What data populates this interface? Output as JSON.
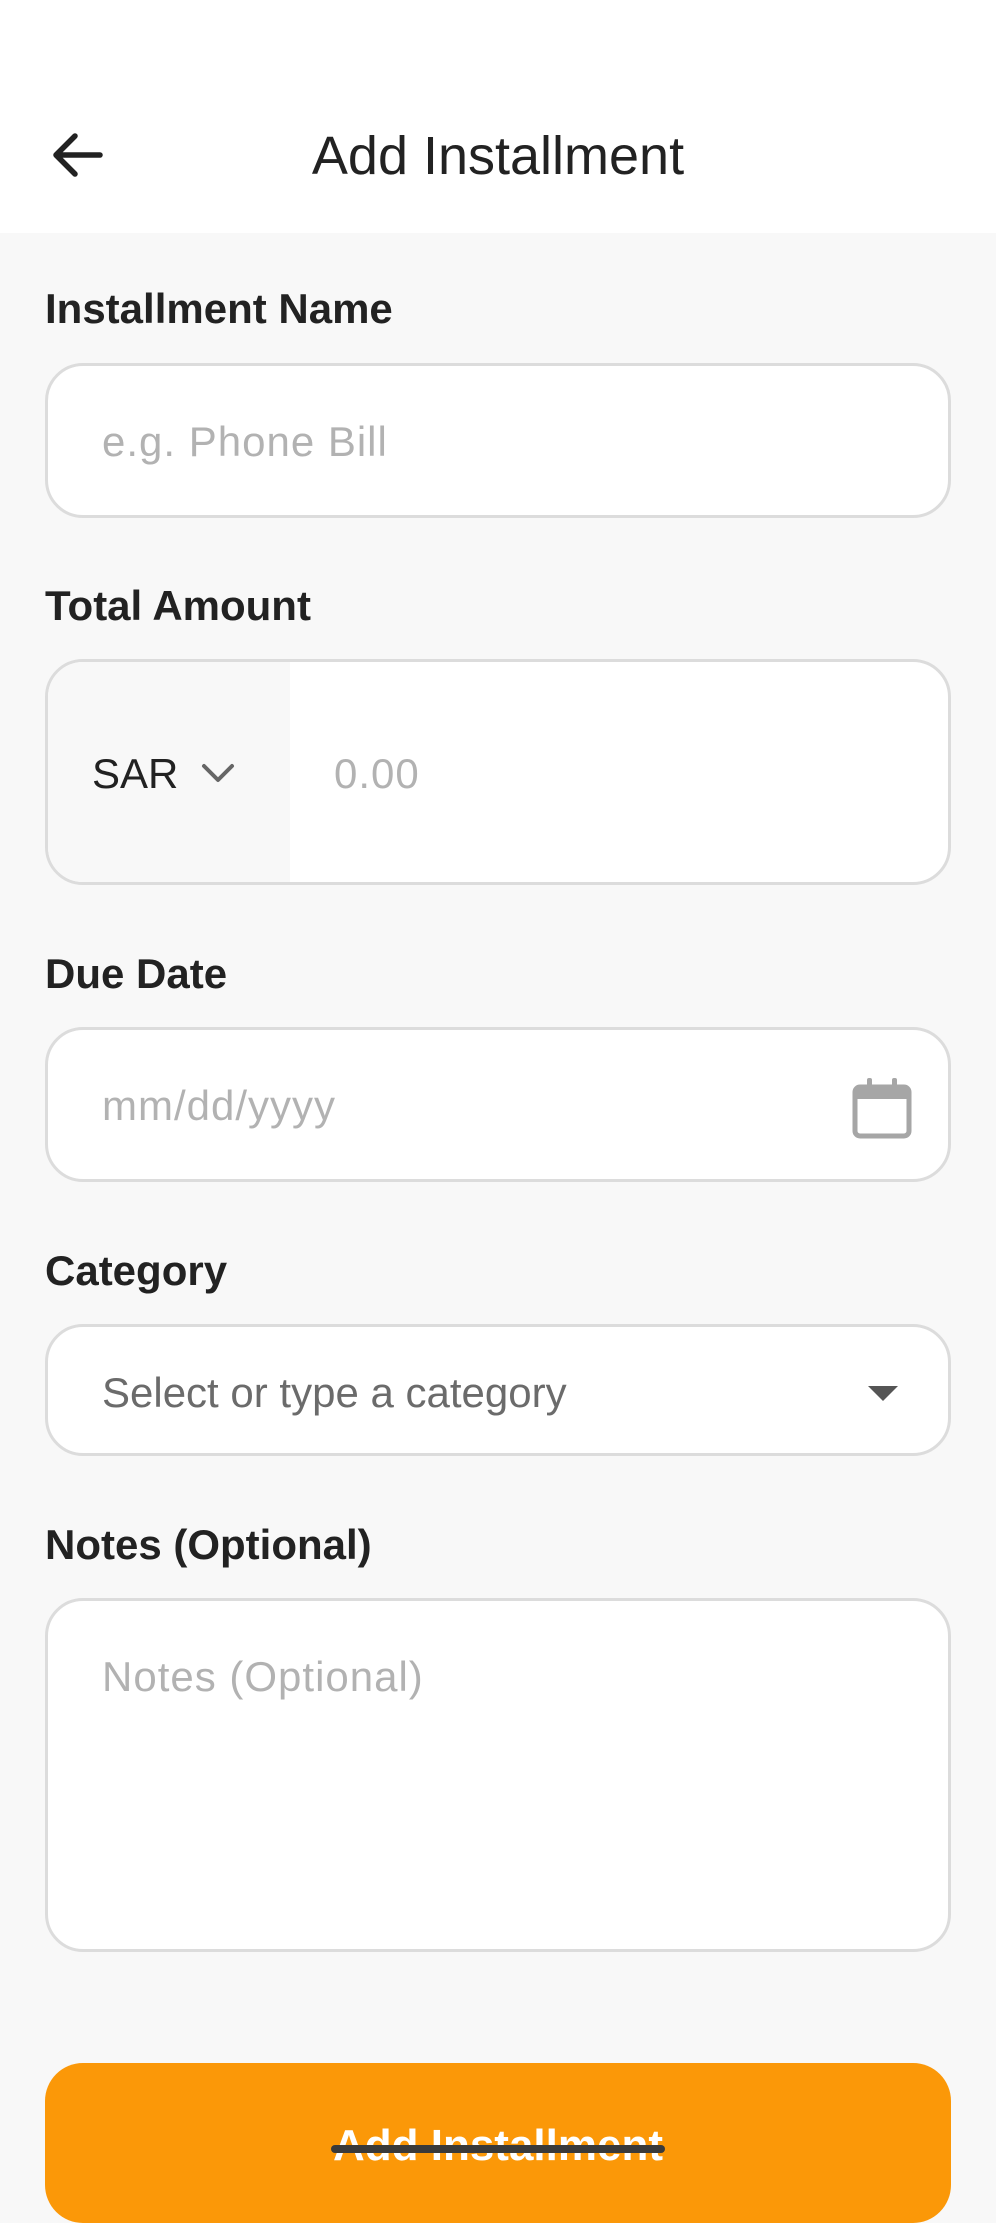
{
  "header": {
    "title": "Add Installment",
    "back_icon": "arrow-left-icon"
  },
  "form": {
    "name": {
      "label": "Installment Name",
      "placeholder": "e.g. Phone Bill",
      "value": ""
    },
    "amount": {
      "label": "Total Amount",
      "currency": "SAR",
      "currency_icon": "chevron-down-icon",
      "placeholder": "0.00",
      "value": ""
    },
    "due_date": {
      "label": "Due Date",
      "placeholder": "mm/dd/yyyy",
      "icon": "calendar-icon",
      "value": ""
    },
    "category": {
      "label": "Category",
      "placeholder": "Select or type a category",
      "icon": "dropdown-caret-icon"
    },
    "notes": {
      "label": "Notes (Optional)",
      "placeholder": "Notes (Optional)",
      "value": ""
    }
  },
  "submit": {
    "label": "Add Installment"
  },
  "colors": {
    "accent": "#fb9808",
    "background": "#f8f8f8",
    "surface": "#ffffff",
    "border": "#dcdcdc",
    "placeholder": "#b2b2b2",
    "text": "#222222"
  }
}
